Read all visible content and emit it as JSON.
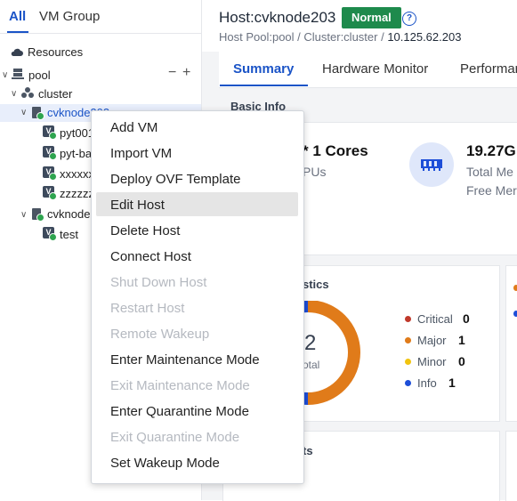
{
  "left_panel": {
    "tabs": {
      "all": "All",
      "vm_group": "VM Group"
    },
    "tree": {
      "resources": "Resources",
      "pool": "pool",
      "pool_actions": {
        "collapse": "−",
        "add": "+"
      },
      "cluster": "cluster",
      "host1": "cvknode203",
      "vms_host1": [
        "pyt001",
        "pyt-ba",
        "xxxxxx",
        "zzzzzz"
      ],
      "host2": "cvknode",
      "vms_host2": [
        "test"
      ]
    }
  },
  "header": {
    "title": "Host:cvknode203",
    "status_badge": "Normal",
    "help": "?",
    "breadcrumb": "Host Pool:pool / Cluster:cluster / ",
    "breadcrumb_ip": "10.125.62.203"
  },
  "tabs": [
    "Summary",
    "Hardware Monitor",
    "Performan"
  ],
  "basic_info": {
    "title": "Basic Info",
    "cpu_cores": "* 1 Cores",
    "cpu_sub": "PUs",
    "memory": "19.27G",
    "memory_total": "Total Me",
    "memory_free": "Free Mer"
  },
  "alarm": {
    "title_fragment": "stics",
    "total_count": "2",
    "total_label": "otal",
    "legend": [
      {
        "label": "Critical",
        "value": "0",
        "color": "#c0392b"
      },
      {
        "label": "Major",
        "value": "1",
        "color": "#e07b1a"
      },
      {
        "label": "Minor",
        "value": "0",
        "color": "#f1c40f"
      },
      {
        "label": "Info",
        "value": "1",
        "color": "#1d4ed8"
      }
    ]
  },
  "bottom_card_fragment": "ts",
  "context_menu": {
    "items": [
      {
        "label": "Add VM",
        "enabled": true
      },
      {
        "label": "Import VM",
        "enabled": true
      },
      {
        "label": "Deploy OVF Template",
        "enabled": true
      },
      {
        "label": "Edit Host",
        "enabled": true,
        "highlighted": true
      },
      {
        "label": "Delete Host",
        "enabled": true
      },
      {
        "label": "Connect Host",
        "enabled": true
      },
      {
        "label": "Shut Down Host",
        "enabled": false
      },
      {
        "label": "Restart Host",
        "enabled": false
      },
      {
        "label": "Remote Wakeup",
        "enabled": false
      },
      {
        "label": "Enter Maintenance Mode",
        "enabled": true
      },
      {
        "label": "Exit Maintenance Mode",
        "enabled": false
      },
      {
        "label": "Enter Quarantine Mode",
        "enabled": true
      },
      {
        "label": "Exit Quarantine Mode",
        "enabled": false
      },
      {
        "label": "Set Wakeup Mode",
        "enabled": true
      }
    ]
  },
  "colors": {
    "accent": "#1b54c7",
    "status_normal": "#1e8a4c",
    "donut_major": "#e07b1a",
    "donut_info": "#1d4ed8"
  }
}
